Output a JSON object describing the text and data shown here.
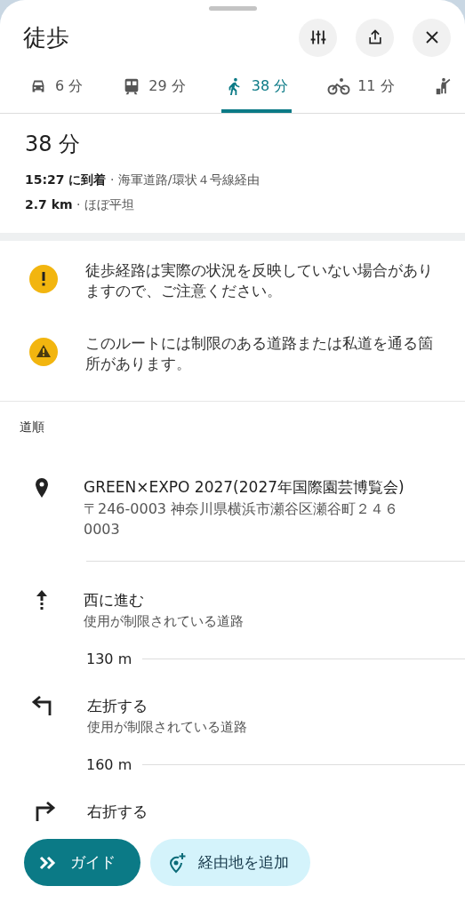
{
  "header": {
    "title": "徒歩"
  },
  "tabs": [
    {
      "kind": "car",
      "label": "6 分",
      "selected": false
    },
    {
      "kind": "train",
      "label": "29 分",
      "selected": false
    },
    {
      "kind": "walk",
      "label": "38 分",
      "selected": true
    },
    {
      "kind": "bike",
      "label": "11 分",
      "selected": false
    },
    {
      "kind": "ride",
      "selected": false
    }
  ],
  "summary": {
    "duration": "38 分",
    "arrival": "15:27 に到着",
    "via": "· 海軍道路/環状４号線経由",
    "distance": "2.7 km",
    "terrain": "· ほぼ平坦"
  },
  "notices": [
    {
      "kind": "info",
      "text": "徒歩経路は実際の状況を反映していない場合がありますので、ご注意ください。"
    },
    {
      "kind": "warning",
      "text": "このルートには制限のある道路または私道を通る箇所があります。"
    }
  ],
  "directions": {
    "heading": "道順",
    "destination": {
      "name": "GREEN×EXPO 2027(2027年国際園芸博覧会)",
      "address": "〒246-0003 神奈川県横浜市瀬谷区瀬谷町２４６0003"
    },
    "steps": [
      {
        "kind": "straight",
        "title": "西に進む",
        "note": "使用が制限されている道路",
        "distance": "130 m"
      },
      {
        "kind": "left",
        "title": "左折する",
        "note": "使用が制限されている道路",
        "distance": "160 m"
      },
      {
        "kind": "right",
        "title": "右折する"
      }
    ]
  },
  "actions": {
    "guide": "ガイド",
    "add_stop": "経由地を追加"
  }
}
